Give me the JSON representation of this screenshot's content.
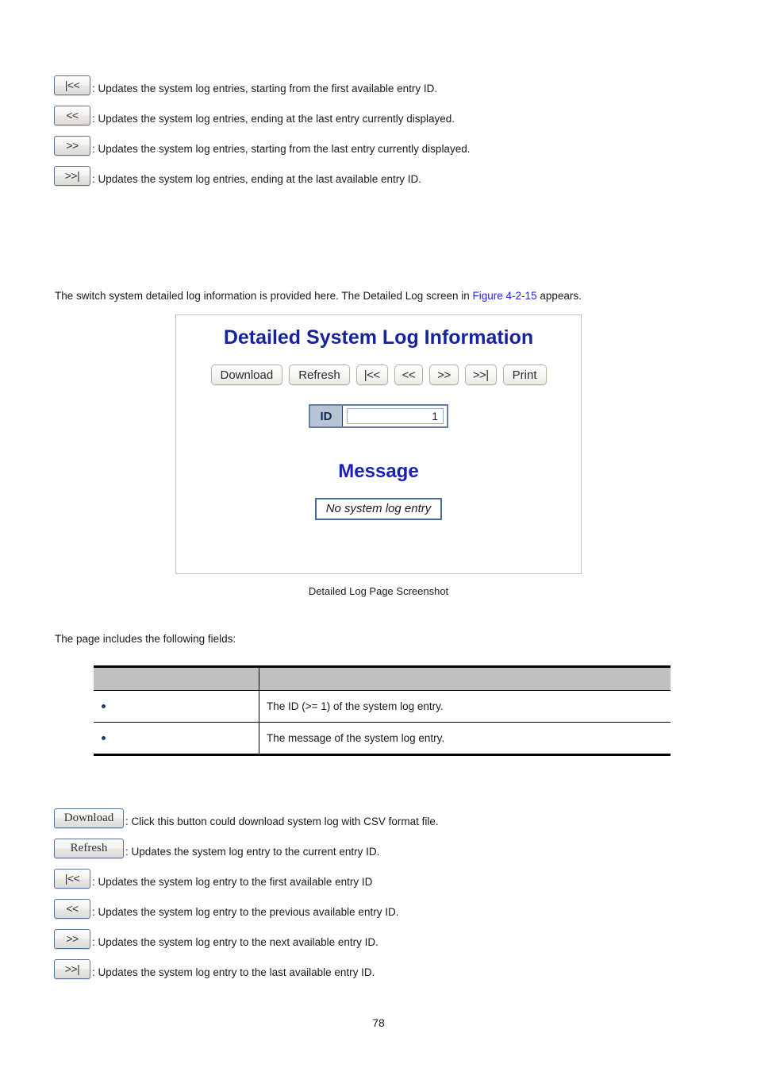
{
  "top_legend": [
    {
      "button": "|<<",
      "icon": "first-page-icon",
      "desc": ": Updates the system log entries, starting from the first available entry ID."
    },
    {
      "button": "<<",
      "icon": "previous-page-icon",
      "desc": ": Updates the system log entries, ending at the last entry currently displayed."
    },
    {
      "button": ">>",
      "icon": "next-page-icon",
      "desc": ": Updates the system log entries, starting from the last entry currently displayed."
    },
    {
      "button": ">>|",
      "icon": "last-page-icon",
      "desc": ": Updates the system log entries, ending at the last available entry ID."
    }
  ],
  "intro": {
    "before_link": "The switch system detailed log information is provided here. The Detailed Log screen in ",
    "link": "Figure 4-2-15",
    "after_link": " appears."
  },
  "figure": {
    "title": "Detailed System Log Information",
    "toolbar": [
      {
        "label": "Download",
        "name": "download-button"
      },
      {
        "label": "Refresh",
        "name": "refresh-button"
      },
      {
        "label": "|<<",
        "name": "first-page-button"
      },
      {
        "label": "<<",
        "name": "previous-page-button"
      },
      {
        "label": ">>",
        "name": "next-page-button"
      },
      {
        "label": ">>|",
        "name": "last-page-button"
      },
      {
        "label": "Print",
        "name": "print-button"
      }
    ],
    "id_label": "ID",
    "id_value": "1",
    "message_heading": "Message",
    "message_value": "No system log entry",
    "caption": "Detailed Log Page Screenshot",
    "title_color": "#16239b",
    "message_heading_color": "#1a1fb5"
  },
  "fields_intro": "The page includes the following fields:",
  "table": {
    "headers": {
      "name": "",
      "description": ""
    },
    "rows": [
      {
        "name": "",
        "description": "The ID (>= 1) of the system log entry."
      },
      {
        "name": "",
        "description": "The message of the system log entry."
      }
    ]
  },
  "bottom_legend": [
    {
      "button": "Download",
      "icon": "download-icon",
      "style": "serif",
      "desc": ": Click this button could download system log with CSV format file."
    },
    {
      "button": "Refresh",
      "icon": "refresh-icon",
      "style": "serif",
      "desc": ": Updates the system log entry to the current entry ID."
    },
    {
      "button": "|<<",
      "icon": "first-page-icon",
      "style": "nav",
      "desc": ": Updates the system log entry to the first available entry ID"
    },
    {
      "button": "<<",
      "icon": "previous-page-icon",
      "style": "nav",
      "desc": ": Updates the system log entry to the previous available entry ID."
    },
    {
      "button": ">>",
      "icon": "next-page-icon",
      "style": "nav",
      "desc": ": Updates the system log entry to the next available entry ID."
    },
    {
      "button": ">>|",
      "icon": "last-page-icon",
      "style": "nav",
      "desc": ": Updates the system log entry to the last available entry ID."
    }
  ],
  "page_number": "78"
}
